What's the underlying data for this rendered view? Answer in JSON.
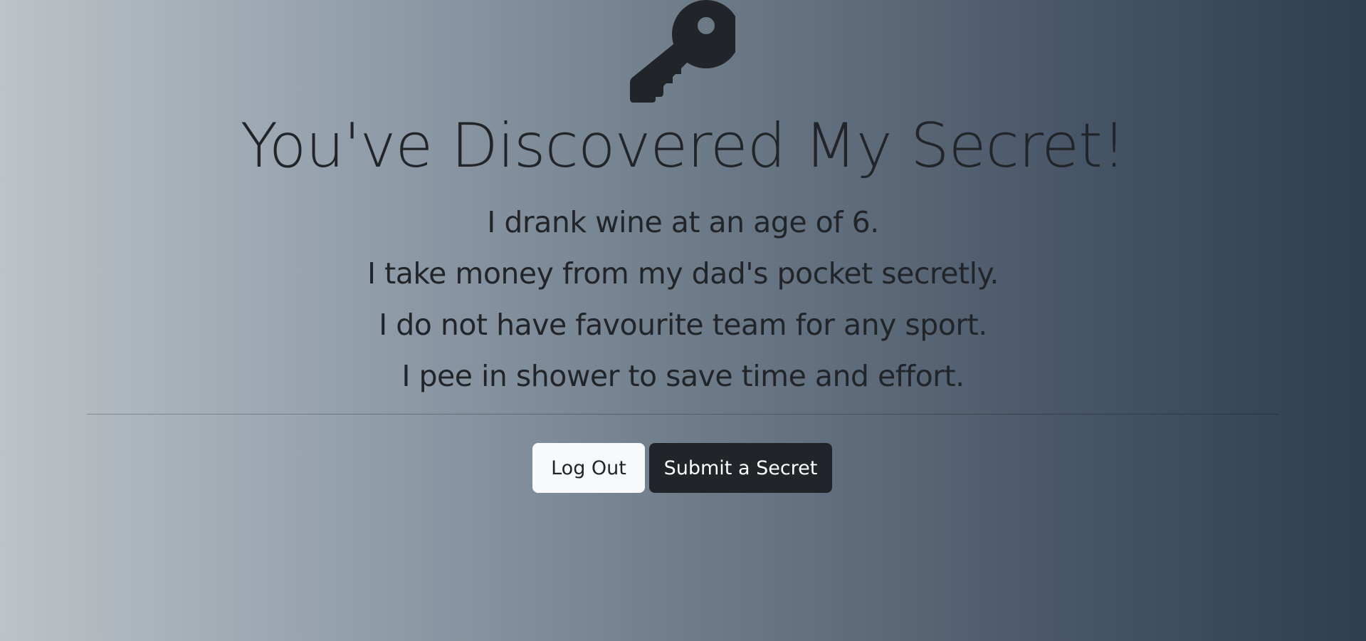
{
  "page": {
    "title": "You've Discovered My Secret!",
    "icon": "key-icon"
  },
  "secrets": [
    "I drank wine at an age of 6.",
    "I take money from my dad's pocket secretly.",
    "I do not have favourite team for any sport.",
    "I pee in shower to save time and effort."
  ],
  "actions": {
    "logout_label": "Log Out",
    "submit_label": "Submit a Secret"
  },
  "colors": {
    "gradient_start": "#bdc3c7",
    "gradient_end": "#2c3e50",
    "text": "#212529",
    "button_light": "#f8f9fa",
    "button_dark": "#212529"
  }
}
